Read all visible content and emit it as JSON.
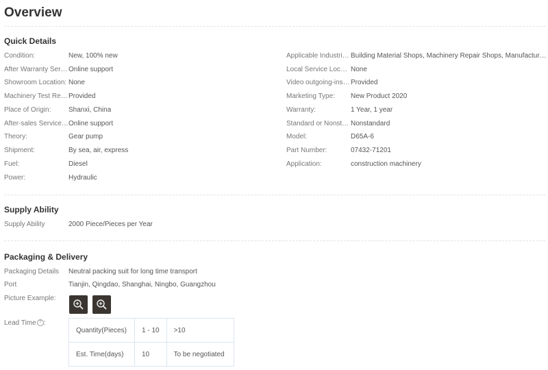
{
  "page_title": "Overview",
  "quick_details": {
    "title": "Quick Details",
    "left": [
      {
        "key": "Condition:",
        "value": "New, 100% new"
      },
      {
        "key": "After Warranty Service:",
        "value": "Online support"
      },
      {
        "key": "Showroom Location:",
        "value": "None"
      },
      {
        "key": "Machinery Test Report:",
        "value": "Provided"
      },
      {
        "key": "Place of Origin:",
        "value": "Shanxi, China"
      },
      {
        "key": "After-sales Service Provided:",
        "value": "Online support"
      },
      {
        "key": "Theory:",
        "value": "Gear pump"
      },
      {
        "key": "Shipment:",
        "value": "By sea, air, express"
      },
      {
        "key": "Fuel:",
        "value": "Diesel"
      },
      {
        "key": "Power:",
        "value": "Hydraulic"
      }
    ],
    "right": [
      {
        "key": "Applicable Industries:",
        "value": "Building Material Shops, Machinery Repair Shops, Manufacturing Plant"
      },
      {
        "key": "Local Service Location:",
        "value": "None"
      },
      {
        "key": "Video outgoing-inspection:",
        "value": "Provided"
      },
      {
        "key": "Marketing Type:",
        "value": "New Product 2020"
      },
      {
        "key": "Warranty:",
        "value": "1 Year, 1 year"
      },
      {
        "key": "Standard or Nonstandard:",
        "value": "Nonstandard"
      },
      {
        "key": "Model:",
        "value": "D65A-6"
      },
      {
        "key": "Part Number:",
        "value": "07432-71201"
      },
      {
        "key": "Application:",
        "value": "construction machinery"
      }
    ]
  },
  "supply_ability": {
    "title": "Supply Ability",
    "key": "Supply Ability",
    "value": "2000 Piece/Pieces per Year"
  },
  "packaging": {
    "title": "Packaging & Delivery",
    "details_key": "Packaging Details",
    "details_value": "Neutral packing suit for long time transport",
    "port_key": "Port",
    "port_value": "Tianjin, Qingdao, Shanghai, Ningbo, Guangzhou",
    "picture_key": "Picture Example:",
    "lead_time_label": "Lead Time",
    "help_glyph": "?",
    "lead_table": {
      "rows": [
        [
          "Quantity(Pieces)",
          "1 - 10",
          ">10"
        ],
        [
          "Est. Time(days)",
          "10",
          "To be negotiated"
        ]
      ]
    }
  }
}
